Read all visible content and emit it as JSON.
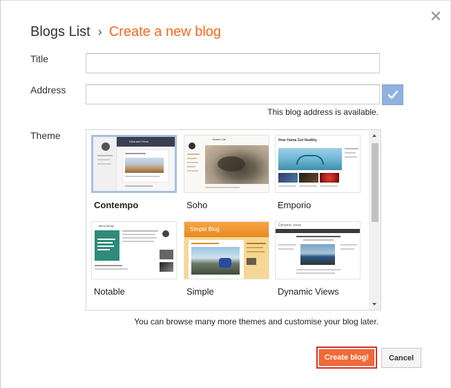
{
  "breadcrumb": {
    "root": "Blogs List",
    "separator": "›",
    "current": "Create a new blog"
  },
  "form": {
    "title_label": "Title",
    "title_value": "",
    "address_label": "Address",
    "address_value": "",
    "address_status": "This blog address is available.",
    "theme_label": "Theme"
  },
  "themes": [
    {
      "name": "Contempo",
      "selected": true,
      "header": "Vista and Trees"
    },
    {
      "name": "Soho",
      "selected": false,
      "header": "Vibrant Life"
    },
    {
      "name": "Emporio",
      "selected": false,
      "header": "How Yaima Got Healthy"
    },
    {
      "name": "Notable",
      "selected": false,
      "header": "Mirror Brady"
    },
    {
      "name": "Simple",
      "selected": false,
      "header": "Simple Blog"
    },
    {
      "name": "Dynamic Views",
      "selected": false,
      "header": "Dynamic views"
    }
  ],
  "browse_note": "You can browse many more themes and customise your blog later.",
  "buttons": {
    "create": "Create blog!",
    "cancel": "Cancel"
  },
  "colors": {
    "accent": "#f26a21",
    "create_bg": "#f16a36",
    "create_border": "#d9302b",
    "check_bg": "#8fb2df",
    "selected_border": "#a9bfe2"
  },
  "icons": {
    "close": "close-icon",
    "check": "checkmark-icon"
  }
}
